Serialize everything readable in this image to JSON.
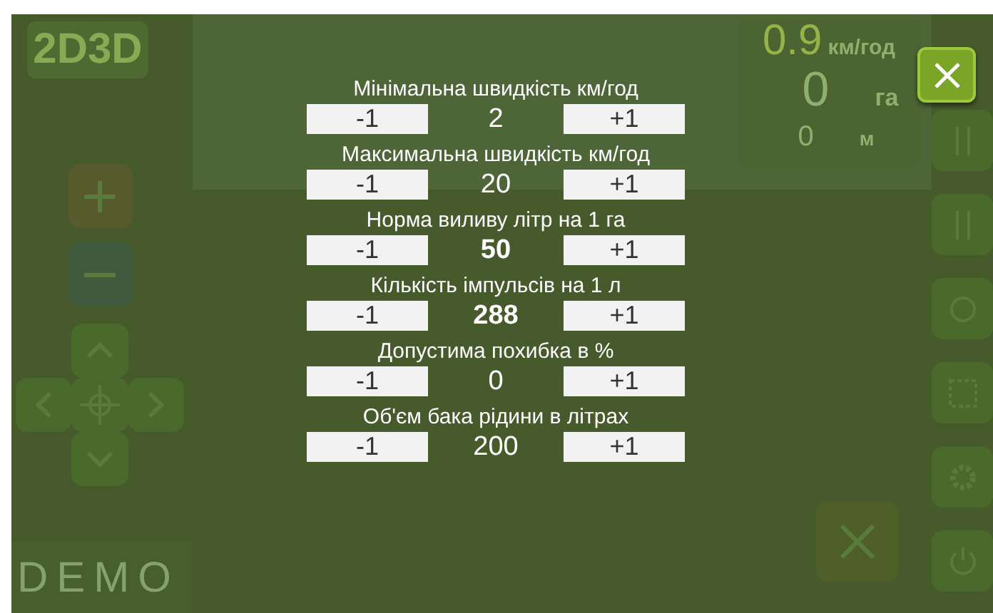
{
  "background": {
    "mode_toggle": [
      "2D",
      "3D"
    ],
    "speed": "0.9",
    "speed_unit": "км/год",
    "area": "0",
    "area_unit": "га",
    "distance": "0",
    "distance_unit": "м",
    "demo_label": "DEMO"
  },
  "settings": [
    {
      "label": "Мінімальна швидкість км/год",
      "decrement": "-1",
      "value": "2",
      "increment": "+1",
      "emphasized": false
    },
    {
      "label": "Максимальна швидкість км/год",
      "decrement": "-1",
      "value": "20",
      "increment": "+1",
      "emphasized": false
    },
    {
      "label": "Норма виливу літр на 1 га",
      "decrement": "-1",
      "value": "50",
      "increment": "+1",
      "emphasized": true
    },
    {
      "label": "Кількість імпульсів на 1 л",
      "decrement": "-1",
      "value": "288",
      "increment": "+1",
      "emphasized": true
    },
    {
      "label": "Допустима похибка в %",
      "decrement": "-1",
      "value": "0",
      "increment": "+1",
      "emphasized": false
    },
    {
      "label": "Об'єм бака рідини в літрах",
      "decrement": "-1",
      "value": "200",
      "increment": "+1",
      "emphasized": false
    }
  ]
}
